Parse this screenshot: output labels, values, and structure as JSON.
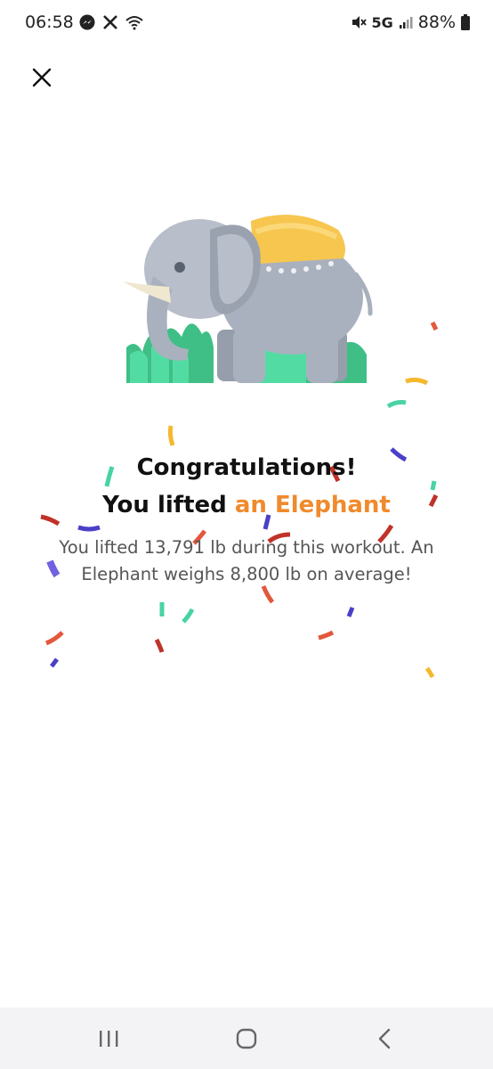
{
  "status_bar": {
    "time": "06:58",
    "left_icons": [
      "messenger-icon",
      "x-icon",
      "wifi-icon"
    ],
    "network": "5G",
    "battery": "88%",
    "right_icons": [
      "mute-icon",
      "signal-icon",
      "battery-icon"
    ]
  },
  "header": {
    "close_icon": "close-icon"
  },
  "illustration": {
    "subject": "elephant-icon"
  },
  "content": {
    "title_line1": "Congratulations!",
    "title_line2_prefix": "You lifted ",
    "title_line2_accent": "an Elephant",
    "message": "You lifted 13,791 lb during this workout. An Elephant weighs 8,800 lb on average!"
  },
  "colors": {
    "accent": "#f08a2c",
    "elephant_body": "#a9b0bd",
    "saddle": "#f7c64f",
    "grass": "#4fd6a0"
  },
  "nav_bar": {
    "icons": [
      "recents-icon",
      "home-icon",
      "back-icon"
    ]
  }
}
